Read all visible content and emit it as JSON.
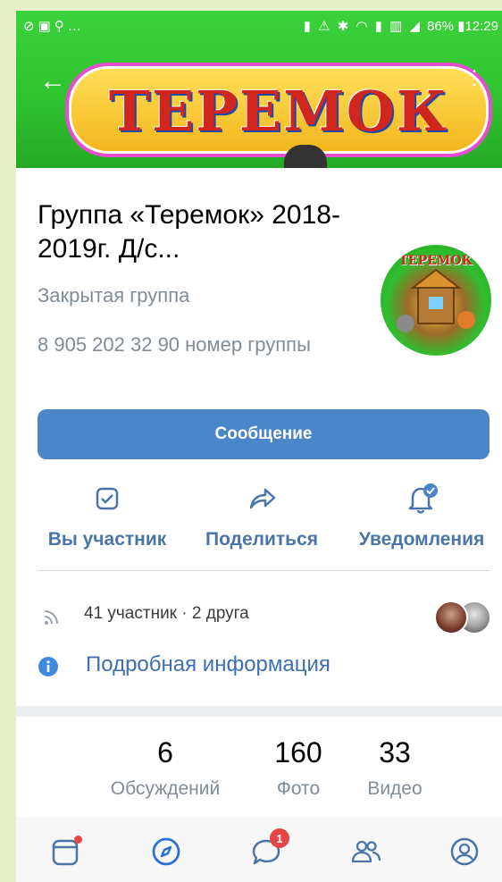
{
  "status_bar": {
    "left_icons": [
      "link-icon",
      "image-icon",
      "search-icon",
      "more-dots-icon"
    ],
    "battery": "86%",
    "time": "12:29"
  },
  "banner": {
    "logo_text": "ТЕРЕМОК"
  },
  "group": {
    "title": "Группа «Теремок» 2018-2019г. Д/с...",
    "type": "Закрытая группа",
    "status": "8 905 202 32 90 номер группы",
    "avatar_text": "ТЕРЕМОК"
  },
  "message_button": "Сообщение",
  "actions": [
    {
      "label": "Вы участник",
      "icon": "check-square-icon"
    },
    {
      "label": "Поделиться",
      "icon": "share-arrow-icon"
    },
    {
      "label": "Уведомления",
      "icon": "bell-check-icon"
    }
  ],
  "members": {
    "text": "41 участник · 2 друга"
  },
  "info_link": "Подробная информация",
  "counters": [
    {
      "value": "6",
      "label": "Обсуждений"
    },
    {
      "value": "160",
      "label": "Фото"
    },
    {
      "value": "33",
      "label": "Видео"
    }
  ],
  "tabbar": {
    "messages_badge": "1"
  },
  "colors": {
    "accent": "#4a86c8",
    "link": "#3f6fb0",
    "secondary_text": "#818c99",
    "banner_green": "#2fc42f"
  }
}
